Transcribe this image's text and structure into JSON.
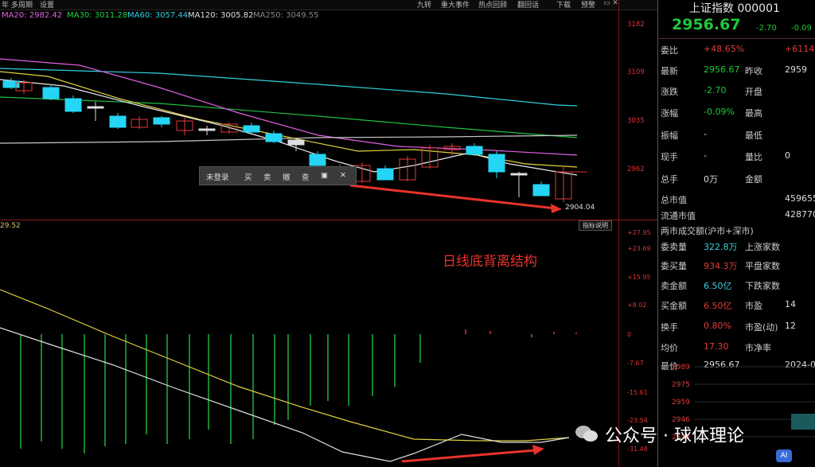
{
  "topbar": {
    "left_items": [
      "年",
      "多周期",
      "设置"
    ],
    "right_items": [
      "九转",
      "重大事件",
      "热点回顾",
      "翻回话",
      "下载",
      "预警"
    ]
  },
  "ma_legend": [
    {
      "label": "MA20: 2982.42",
      "color": "#e060e0"
    },
    {
      "label": "MA30: 3011.28",
      "color": "#20d040"
    },
    {
      "label": "MA60: 3057.44",
      "color": "#30d0e0"
    },
    {
      "label": "MA120: 3005.82",
      "color": "#e0e0e0"
    },
    {
      "label": "MA250: 3049.55",
      "color": "#777777"
    }
  ],
  "price_axis": [
    "3182",
    "3109",
    "3035",
    "2962"
  ],
  "price_low_label": "2904.04",
  "toolbar": {
    "items": [
      "未登录",
      "买",
      "卖",
      "撤",
      "查"
    ]
  },
  "sub_indicator_tag": "29.52",
  "sub_button": "指标说明",
  "sub_axis": [
    "+27.95",
    "+23.69",
    "+15.95",
    "+8.02",
    "0",
    "-7.67",
    "-15.61",
    "-23.54",
    "-31.48"
  ],
  "annotation": "日线底背离结构",
  "panel": {
    "title": "上证指数 000001",
    "price": "2956.67",
    "change": "-2.70",
    "change_pct": "-0.09",
    "rows": [
      {
        "l1": "委比",
        "v1": "+48.65%",
        "c1": "red",
        "l2": "",
        "v2": "+6114",
        "c2": "red"
      },
      {
        "l1": "最新",
        "v1": "2956.67",
        "c1": "grn",
        "l2": "昨收",
        "v2": "2959",
        "c2": "wht"
      },
      {
        "l1": "涨跌",
        "v1": "-2.70",
        "c1": "grn",
        "l2": "开盘",
        "v2": "",
        "c2": "wht"
      },
      {
        "l1": "涨幅",
        "v1": "-0.09%",
        "c1": "grn",
        "l2": "最高",
        "v2": "",
        "c2": "wht"
      },
      {
        "l1": "振幅",
        "v1": "-",
        "c1": "wht",
        "l2": "最低",
        "v2": "",
        "c2": "wht"
      },
      {
        "l1": "现手",
        "v1": "-",
        "c1": "wht",
        "l2": "量比",
        "v2": "0",
        "c2": "wht"
      },
      {
        "l1": "总手",
        "v1": "0万",
        "c1": "wht",
        "l2": "金额",
        "v2": "",
        "c2": "wht"
      },
      {
        "l1": "总市值",
        "v1": "",
        "c1": "wht",
        "l2": "",
        "v2": "459655",
        "c2": "wht"
      },
      {
        "l1": "流通市值",
        "v1": "",
        "c1": "wht",
        "l2": "",
        "v2": "428770",
        "c2": "wht"
      },
      {
        "l1": "两市成交额(沪市+深市)",
        "v1": "",
        "c1": "wht",
        "l2": "",
        "v2": "",
        "c2": "wht"
      },
      {
        "l1": "委卖量",
        "v1": "322.8万",
        "c1": "cyan",
        "l2": "上涨家数",
        "v2": "",
        "c2": "wht"
      },
      {
        "l1": "委买量",
        "v1": "934.3万",
        "c1": "red",
        "l2": "平盘家数",
        "v2": "",
        "c2": "wht"
      },
      {
        "l1": "卖金额",
        "v1": "6.50亿",
        "c1": "cyan",
        "l2": "下跌家数",
        "v2": "",
        "c2": "wht"
      },
      {
        "l1": "买金额",
        "v1": "6.50亿",
        "c1": "red",
        "l2": "市盈",
        "v2": "14",
        "c2": "wht"
      },
      {
        "l1": "换手",
        "v1": "0.80%",
        "c1": "red",
        "l2": "市盈(动)",
        "v2": "12",
        "c2": "wht"
      },
      {
        "l1": "均价",
        "v1": "17.30",
        "c1": "red",
        "l2": "市净率",
        "v2": "",
        "c2": "wht"
      },
      {
        "l1": "最价",
        "v1": "2956.67",
        "c1": "wht",
        "l2": "",
        "v2": "2024-07-10",
        "c2": "wht"
      }
    ],
    "mini_axis": [
      "2989",
      "2975",
      "2959",
      "2946",
      "2930"
    ]
  },
  "watermark": "公众号 · 球体理论",
  "ai_badge": "AI",
  "colors": {
    "up": "#e23a3a",
    "down": "#25d5f5",
    "ma5": "#e0e0e0",
    "ma10": "#e0d040",
    "ma20": "#e060e0",
    "ma30": "#20c040",
    "ma60": "#30d0e0",
    "macd_pos": "#e23a3a",
    "macd_neg": "#20c040"
  }
}
